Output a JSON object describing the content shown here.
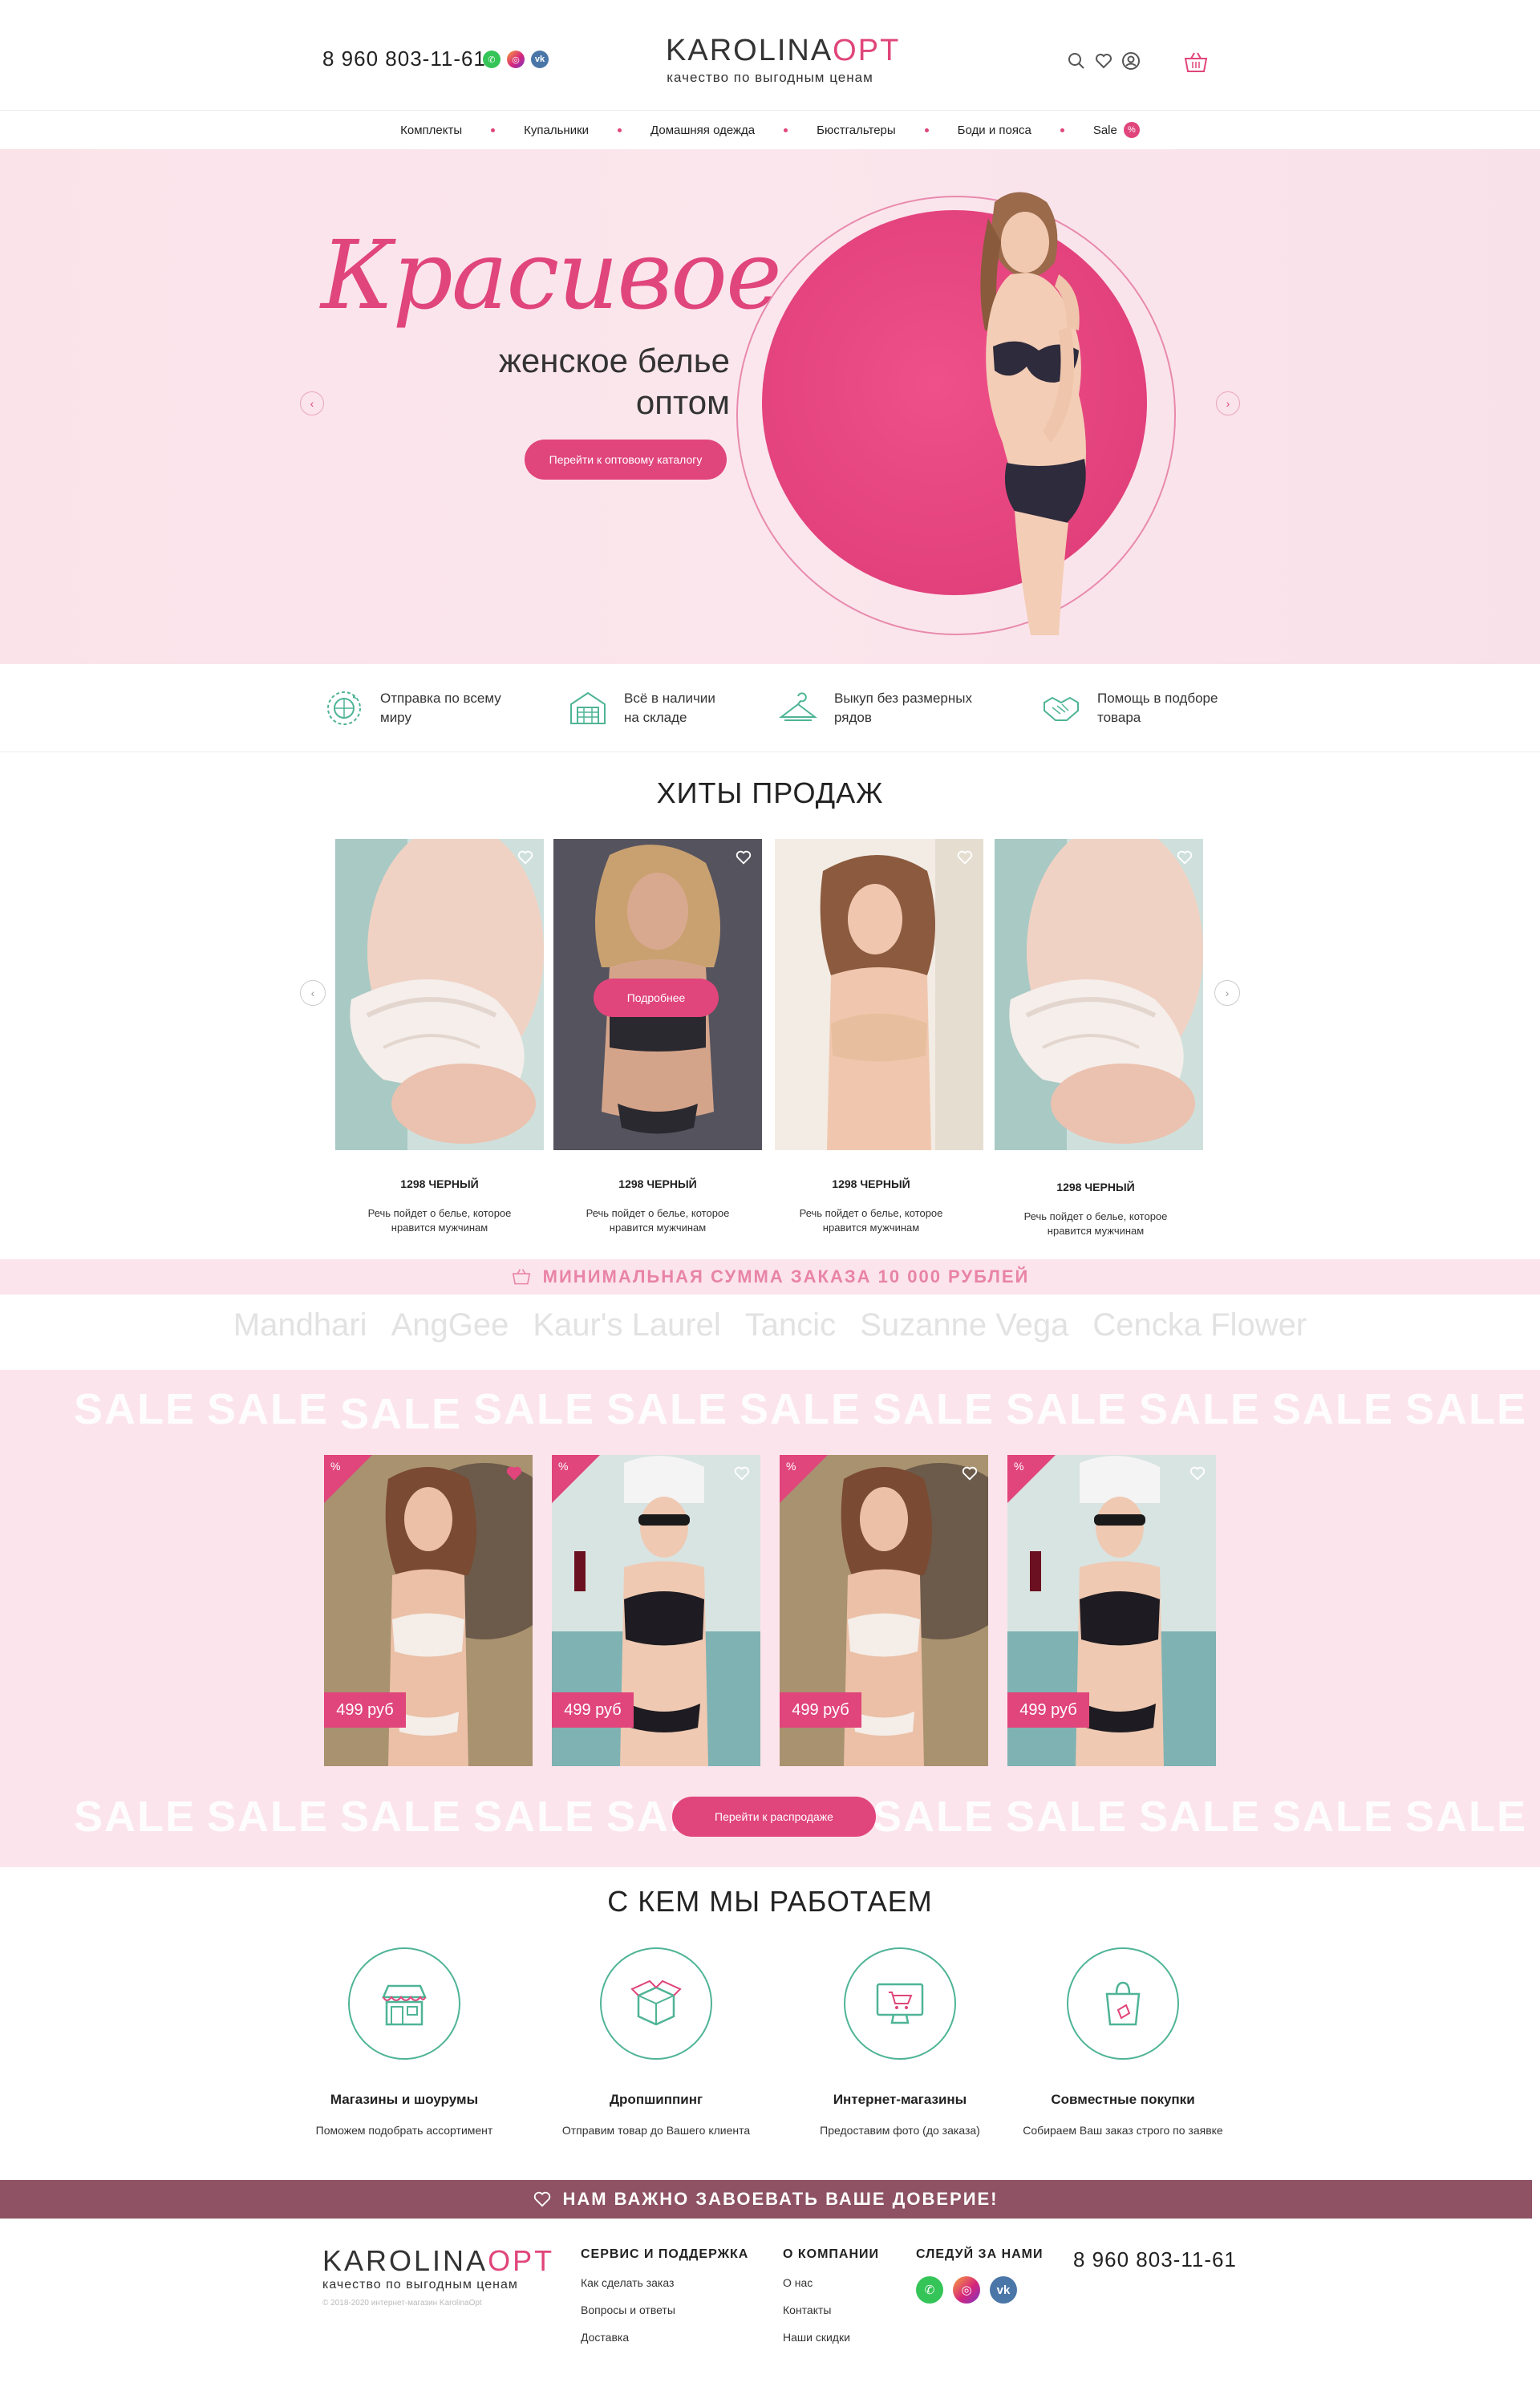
{
  "header": {
    "phone": "8 960 803-11-61",
    "logo_main": "KAROLINA",
    "logo_opt": "OPT",
    "logo_sub": "качество по выгодным ценам"
  },
  "nav": {
    "items": [
      "Комплекты",
      "Купальники",
      "Домашняя одежда",
      "Бюстгальтеры",
      "Боди и пояса",
      "Sale"
    ],
    "sale_badge": "%"
  },
  "hero": {
    "script_title": "Красивое",
    "subtitle_line1": "женское белье",
    "subtitle_line2": "оптом",
    "button": "Перейти к оптовому каталогу",
    "prev": "‹",
    "next": "›"
  },
  "features": [
    {
      "line1": "Отправка по всему",
      "line2": "миру",
      "icon": "globe-delivery-icon"
    },
    {
      "line1": "Всё в наличии",
      "line2": "на складе",
      "icon": "warehouse-icon"
    },
    {
      "line1": "Выкуп без размерных",
      "line2": "рядов",
      "icon": "hanger-icon"
    },
    {
      "line1": "Помощь в подборе",
      "line2": "товара",
      "icon": "handshake-icon"
    }
  ],
  "hits": {
    "title": "ХИТЫ ПРОДАЖ",
    "more_button": "Подробнее",
    "items": [
      {
        "name": "1298 ЧЕРНЫЙ",
        "desc1": "Речь пойдет о белье, которое",
        "desc2": "нравится мужчинам"
      },
      {
        "name": "1298 ЧЕРНЫЙ",
        "desc1": "Речь пойдет о белье, которое",
        "desc2": "нравится мужчинам"
      },
      {
        "name": "1298 ЧЕРНЫЙ",
        "desc1": "Речь пойдет о белье, которое",
        "desc2": "нравится мужчинам"
      },
      {
        "name": "1298 ЧЕРНЫЙ",
        "desc1": "Речь пойдет о белье, которое",
        "desc2": "нравится мужчинам"
      }
    ]
  },
  "min_order": "МИНИМАЛЬНАЯ СУММА ЗАКАЗА 10 000 РУБЛЕЙ",
  "brands": [
    "Mandhari",
    "AngGee",
    "Kaur's Laurel",
    "Tancic",
    "Suzanne Vega",
    "Cencka Flower"
  ],
  "sale": {
    "word": "SALE",
    "prices": [
      "499 руб",
      "499 руб",
      "499 руб",
      "499 руб"
    ],
    "button": "Перейти к распродаже",
    "corner_icon": "%"
  },
  "work": {
    "title": "С КЕМ МЫ РАБОТАЕМ",
    "items": [
      {
        "title": "Магазины и шоурумы",
        "desc": "Поможем подобрать ассортимент"
      },
      {
        "title": "Дропшиппинг",
        "desc": "Отправим товар до Вашего клиента"
      },
      {
        "title": "Интернет-магазины",
        "desc": "Предоставим фото (до заказа)"
      },
      {
        "title": "Совместные покупки",
        "desc": "Собираем Ваш заказ строго по заявке"
      }
    ]
  },
  "trust": "НАМ ВАЖНО ЗАВОЕВАТЬ ВАШЕ ДОВЕРИЕ!",
  "footer": {
    "logo_main": "KAROLINA",
    "logo_opt": "OPT",
    "logo_sub": "качество по выгодным ценам",
    "copyright": "© 2018-2020 интернет-магазин KarolinaOpt",
    "service_title": "СЕРВИС И ПОДДЕРЖКА",
    "service_links": [
      "Как сделать заказ",
      "Вопросы и ответы",
      "Доставка"
    ],
    "company_title": "О КОМПАНИИ",
    "company_links": [
      "О нас",
      "Контакты",
      "Наши скидки"
    ],
    "follow_title": "СЛЕДУЙ ЗА НАМИ",
    "phone": "8 960 803-11-61"
  },
  "colors": {
    "accent": "#e0457b",
    "hero_bg": "#fbe3ea",
    "sale_bg": "#fce4ec",
    "trust_bg": "#8e5264",
    "teal_icon": "#4fb496"
  }
}
